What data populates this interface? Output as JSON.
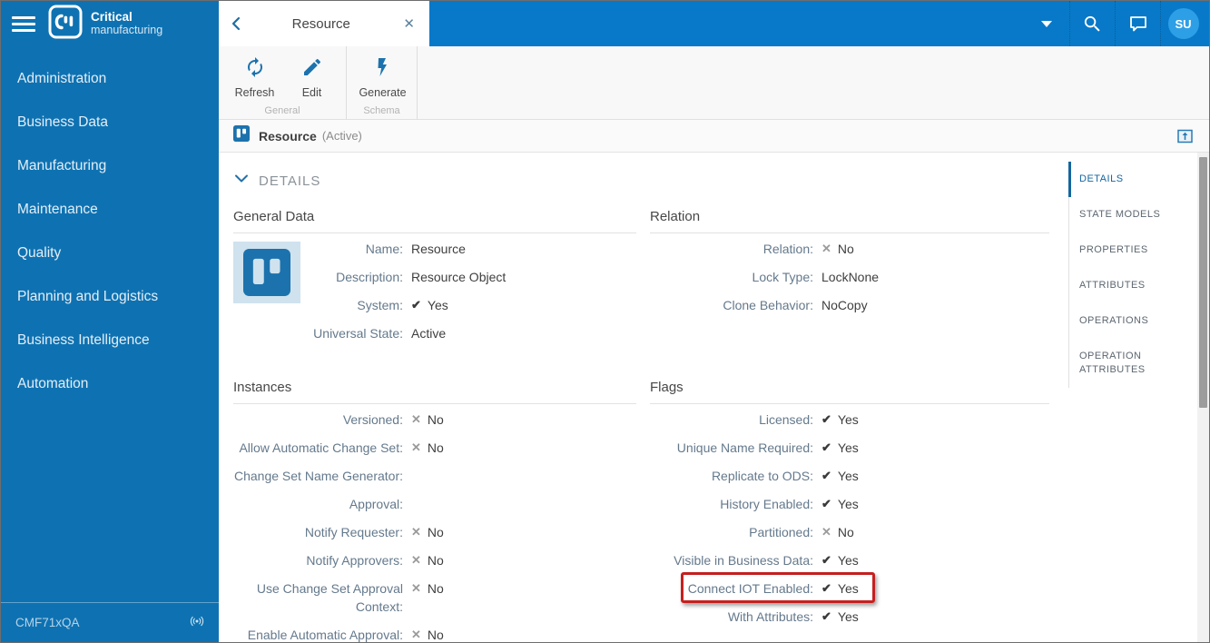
{
  "colors": {
    "sidebar_blue": "#0e72b2",
    "topbar_blue": "#0779c8",
    "accent_blue": "#1c72ad",
    "avatar_blue": "#2d9fe6",
    "annotation_red": "#c4201f"
  },
  "sidebar": {
    "logo_line1": "Critical",
    "logo_line2": "manufacturing",
    "items": [
      "Administration",
      "Business Data",
      "Manufacturing",
      "Maintenance",
      "Quality",
      "Planning and Logistics",
      "Business Intelligence",
      "Automation"
    ],
    "environment": "CMF71xQA"
  },
  "topbar": {
    "tab": {
      "title": "Resource"
    },
    "avatar_initials": "SU"
  },
  "toolbar": {
    "groups": [
      {
        "label": "General",
        "buttons": [
          {
            "label": "Refresh"
          },
          {
            "label": "Edit"
          }
        ]
      },
      {
        "label": "Schema",
        "buttons": [
          {
            "label": "Generate"
          }
        ]
      }
    ]
  },
  "entity_header": {
    "title": "Resource",
    "state": "(Active)"
  },
  "details": {
    "header_label": "DETAILS",
    "sections": {
      "general_data": {
        "title": "General Data",
        "fields": [
          {
            "label": "Name:",
            "value": "Resource"
          },
          {
            "label": "Description:",
            "value": "Resource Object"
          },
          {
            "label": "System:",
            "value": "Yes",
            "mark": "✔",
            "mark_type": "check"
          },
          {
            "label": "Universal State:",
            "value": "Active"
          }
        ]
      },
      "relation": {
        "title": "Relation",
        "fields": [
          {
            "label": "Relation:",
            "value": "No",
            "mark": "✕",
            "mark_type": "cross"
          },
          {
            "label": "Lock Type:",
            "value": "LockNone"
          },
          {
            "label": "Clone Behavior:",
            "value": "NoCopy"
          }
        ]
      },
      "instances": {
        "title": "Instances",
        "fields": [
          {
            "label": "Versioned:",
            "value": "No",
            "mark": "✕",
            "mark_type": "cross"
          },
          {
            "label": "Allow Automatic Change Set:",
            "value": "No",
            "mark": "✕",
            "mark_type": "cross"
          },
          {
            "label": "Change Set Name Generator:",
            "value": ""
          },
          {
            "label": "Approval:",
            "value": ""
          },
          {
            "label": "Notify Requester:",
            "value": "No",
            "mark": "✕",
            "mark_type": "cross"
          },
          {
            "label": "Notify Approvers:",
            "value": "No",
            "mark": "✕",
            "mark_type": "cross"
          },
          {
            "label": "Use Change Set Approval Context:",
            "value": "No",
            "mark": "✕",
            "mark_type": "cross"
          },
          {
            "label": "Enable Automatic Approval:",
            "value": "No",
            "mark": "✕",
            "mark_type": "cross"
          }
        ]
      },
      "flags": {
        "title": "Flags",
        "fields": [
          {
            "label": "Licensed:",
            "value": "Yes",
            "mark": "✔",
            "mark_type": "check"
          },
          {
            "label": "Unique Name Required:",
            "value": "Yes",
            "mark": "✔",
            "mark_type": "check"
          },
          {
            "label": "Replicate to ODS:",
            "value": "Yes",
            "mark": "✔",
            "mark_type": "check"
          },
          {
            "label": "History Enabled:",
            "value": "Yes",
            "mark": "✔",
            "mark_type": "check"
          },
          {
            "label": "Partitioned:",
            "value": "No",
            "mark": "✕",
            "mark_type": "cross"
          },
          {
            "label": "Visible in Business Data:",
            "value": "Yes",
            "mark": "✔",
            "mark_type": "check"
          },
          {
            "label": "Connect IOT Enabled:",
            "value": "Yes",
            "mark": "✔",
            "mark_type": "check",
            "highlighted": true
          },
          {
            "label": "With Attributes:",
            "value": "Yes",
            "mark": "✔",
            "mark_type": "check"
          }
        ]
      }
    }
  },
  "right_nav": {
    "items": [
      {
        "label": "DETAILS",
        "active": true
      },
      {
        "label": "STATE MODELS"
      },
      {
        "label": "PROPERTIES"
      },
      {
        "label": "ATTRIBUTES"
      },
      {
        "label": "OPERATIONS"
      },
      {
        "label": "OPERATION ATTRIBUTES"
      }
    ]
  }
}
